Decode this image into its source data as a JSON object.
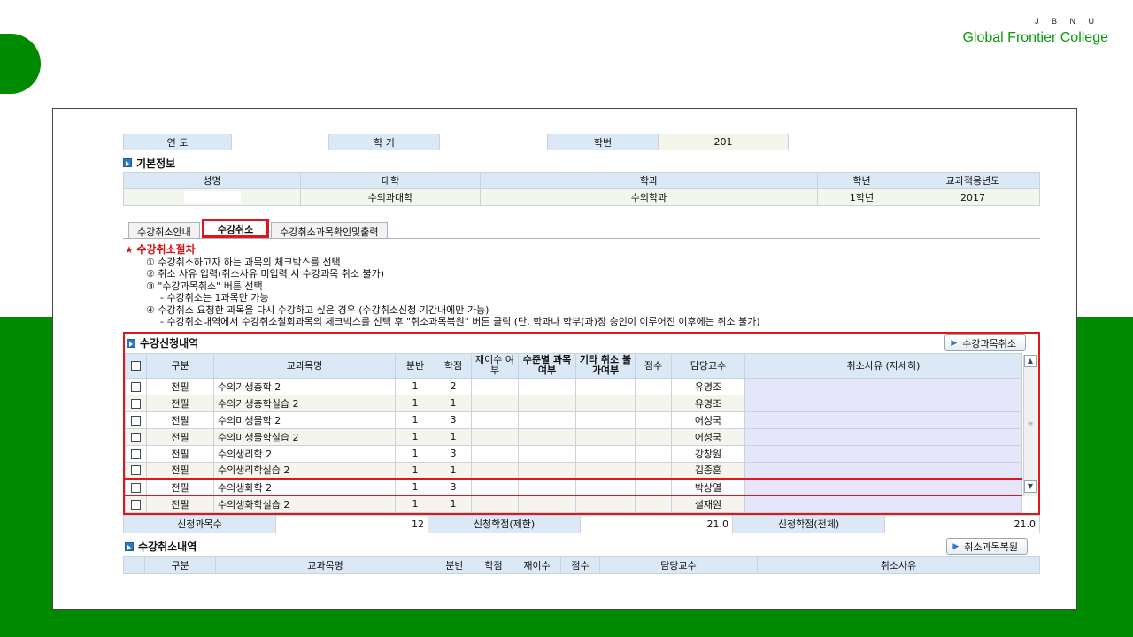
{
  "brand": {
    "small": "J B N U",
    "main": "Global Frontier College"
  },
  "top_row": {
    "year_label": "연    도",
    "term_label": "학    기",
    "student_no_label": "학번",
    "student_no_value": "201"
  },
  "basic_info": {
    "title": "기본정보",
    "headers": [
      "성명",
      "대학",
      "학과",
      "학년",
      "교과적용년도"
    ],
    "values": [
      "",
      "수의과대학",
      "수의학과",
      "1학년",
      "2017"
    ]
  },
  "tabs": [
    "수강취소안내",
    "수강취소",
    "수강취소과목확인및출력"
  ],
  "notes": {
    "title": "수강취소절차",
    "lines": [
      "① 수강취소하고자 하는 과목의 체크박스를 선택",
      "② 취소 사유 입력(취소사유 미입력 시 수강과목 취소 불가)",
      "③ \"수강과목취소\" 버튼 선택",
      "- 수강취소는 1과목만 가능",
      "④ 수강취소 요청한 과목을 다시 수강하고 싶은 경우 (수강취소신청 기간내에만 가능)",
      "- 수강취소내역에서 수강취소철회과목의 체크박스를 선택 후 \"취소과목복원\" 버튼 클릭 (단, 학과나 학부(과)장 승인이 이루어진 이후에는 취소 불가)"
    ]
  },
  "enroll": {
    "title": "수강신청내역",
    "cancel_button": "수강과목취소",
    "headers": [
      "구분",
      "교과목명",
      "분반",
      "학점",
      "재이수 여부",
      "수준별 과목 여부",
      "기타 취소 불가여부",
      "점수",
      "담당교수",
      "취소사유 (자세히)"
    ],
    "rows": [
      {
        "type": "전필",
        "name": "수의기생충학 2",
        "section": "1",
        "credit": "2",
        "prof": "유명조"
      },
      {
        "type": "전필",
        "name": "수의기생충학실습 2",
        "section": "1",
        "credit": "1",
        "prof": "유명조"
      },
      {
        "type": "전필",
        "name": "수의미생물학 2",
        "section": "1",
        "credit": "3",
        "prof": "어성국"
      },
      {
        "type": "전필",
        "name": "수의미생물학실습 2",
        "section": "1",
        "credit": "1",
        "prof": "어성국"
      },
      {
        "type": "전필",
        "name": "수의생리학 2",
        "section": "1",
        "credit": "3",
        "prof": "강창원"
      },
      {
        "type": "전필",
        "name": "수의생리학실습 2",
        "section": "1",
        "credit": "1",
        "prof": "김종훈"
      },
      {
        "type": "전필",
        "name": "수의생화학 2",
        "section": "1",
        "credit": "3",
        "prof": "박상열"
      },
      {
        "type": "전필",
        "name": "수의생화학실습 2",
        "section": "1",
        "credit": "1",
        "prof": "설재원"
      }
    ],
    "summary": {
      "count_label": "신청과목수",
      "count_value": "12",
      "limit_label": "신청학점(제한)",
      "limit_value": "21.0",
      "total_label": "신청학점(전체)",
      "total_value": "21.0"
    }
  },
  "cancelled": {
    "title": "수강취소내역",
    "restore_button": "취소과목복원",
    "headers": [
      "구분",
      "교과목명",
      "분반",
      "학점",
      "재이수",
      "점수",
      "담당교수",
      "취소사유"
    ]
  }
}
